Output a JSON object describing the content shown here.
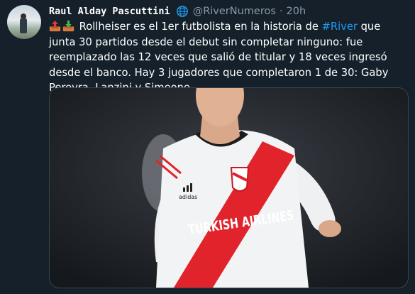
{
  "tweet": {
    "author_name": "Raul Alday Pascuttini",
    "handle": "@RiverNumeros",
    "separator": "·",
    "time": "20h",
    "text_part1": " Rollheiser es el 1er futbolista en la historia de ",
    "hashtag": "#River",
    "text_part2": " que junta 30 partidos desde el debut sin completar ninguno: fue reemplazado las 12 veces que salió de titular y 18 veces ingresó desde el banco. Hay 3 jugadores que completaron 1 de 30: Gaby Pereyra, Lanzini y Simeone.",
    "media": {
      "shirt_sponsor": "TURKISH AIRLINES",
      "shirt_brand": "adidas"
    }
  },
  "colors": {
    "background": "#15202b",
    "hashtag": "#1d9bf0",
    "muted": "#8b98a5"
  },
  "icons": [
    "avatar",
    "globe-icon",
    "outbox-emoji-icon",
    "inbox-emoji-icon"
  ]
}
